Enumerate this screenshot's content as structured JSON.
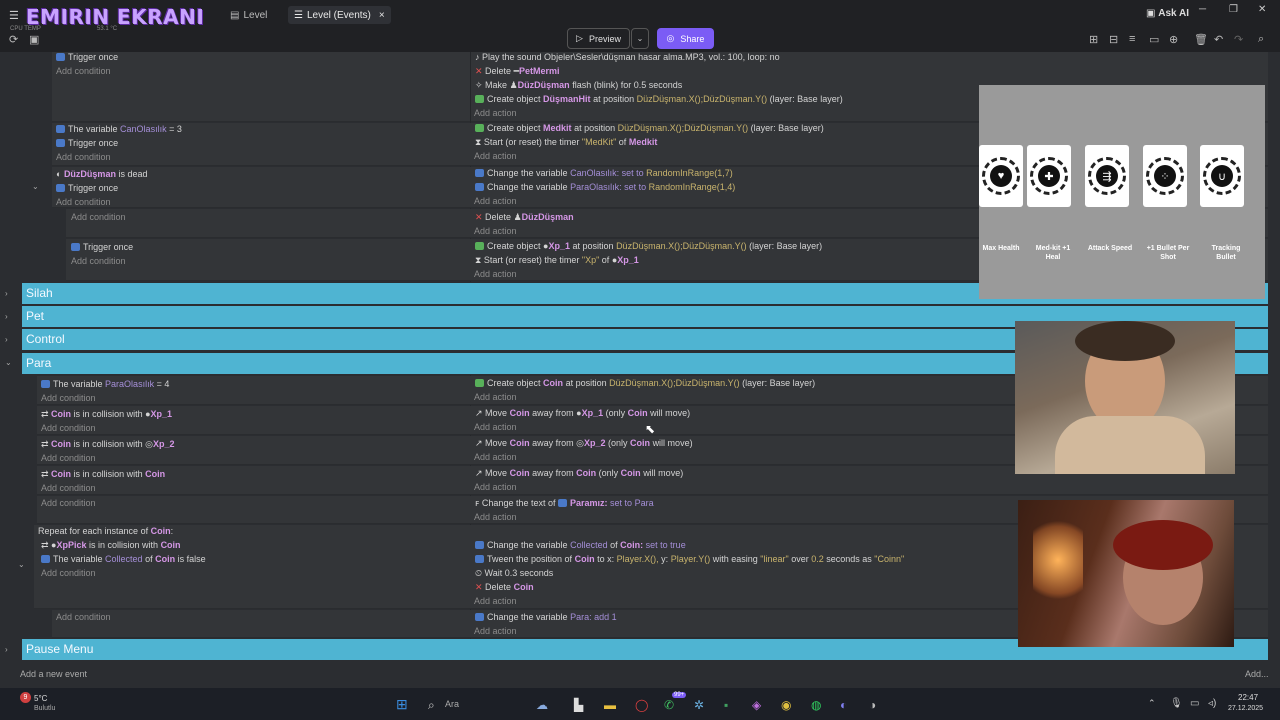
{
  "title_bar": {
    "brand": "EMIRIN EKRANI",
    "tabs": [
      {
        "label": "Level"
      },
      {
        "label": "Level (Events)"
      }
    ],
    "mini_left": "CPU TEMP",
    "mini_temp": "53.1 °C",
    "ask_ai": "Ask AI"
  },
  "toolbar": {
    "preview": "Preview",
    "share": "Share"
  },
  "events": {
    "add_condition": "Add condition",
    "add_action": "Add action",
    "trigger_once": "Trigger once"
  },
  "e1": {
    "a1": "Play the sound Objeler\\Sesler\\düşman hasar alma.MP3, vol.: 100, loop: no",
    "a2_pre": "Delete",
    "a2_obj": "PetMermi",
    "a3_pre": "Make",
    "a3_obj": "DüzDüşman",
    "a3_post": "flash (blink) for 0.5 seconds",
    "a4_pre": "Create object",
    "a4_obj": "DüşmanHit",
    "a4_mid": "at position",
    "a4_val": "DüzDüşman.X();DüzDüşman.Y()",
    "a4_layer": "(layer: Base layer)"
  },
  "e2": {
    "c1_pre": "The variable",
    "c1_var": "CanOlasılık",
    "c1_post": "= 3",
    "a1_pre": "Create object",
    "a1_obj": "Medkit",
    "a1_mid": "at position",
    "a1_val": "DüzDüşman.X();DüzDüşman.Y()",
    "a1_layer": "(layer: Base layer)",
    "a2_pre": "Start (or reset) the timer",
    "a2_val": "\"MedKit\"",
    "a2_of": "of",
    "a2_obj": "Medkit"
  },
  "e3": {
    "c1_obj": "DüzDüşman",
    "c1_post": "is dead",
    "a1_pre": "Change the variable",
    "a1_var": "CanOlasılık:",
    "a1_set": "set to",
    "a1_val": "RandomInRange(1,7)",
    "a2_pre": "Change the variable",
    "a2_var": "ParaOlasılık:",
    "a2_set": "set to",
    "a2_val": "RandomInRange(1,4)"
  },
  "e4": {
    "a1_pre": "Delete",
    "a1_obj": "DüzDüşman"
  },
  "e5": {
    "a1_pre": "Create object",
    "a1_obj": "Xp_1",
    "a1_mid": "at position",
    "a1_val": "DüzDüşman.X();DüzDüşman.Y()",
    "a1_layer": "(layer: Base layer)",
    "a2_pre": "Start (or reset) the timer",
    "a2_val": "\"Xp\"",
    "a2_of": "of",
    "a2_obj": "Xp_1"
  },
  "groups": {
    "silah": "Silah",
    "pet": "Pet",
    "control": "Control",
    "para": "Para",
    "pause": "Pause Menu"
  },
  "para": {
    "c1_pre": "The variable",
    "c1_var": "ParaOlasılık",
    "c1_post": "= 4",
    "a1_pre": "Create object",
    "a1_obj": "Coin",
    "a1_mid": "at position",
    "a1_val": "DüzDüşman.X();DüzDüşman.Y()",
    "a1_layer": "(layer: Base layer)",
    "coll_mid": "is in collision with",
    "coin": "Coin",
    "xp1": "Xp_1",
    "xp2": "Xp_2",
    "move_pre": "Move",
    "move_mid": "away from",
    "move_only": "(only",
    "move_post": "will move)",
    "text_pre": "Change the text of",
    "text_obj": "Paramız:",
    "text_set": "set to",
    "text_val": "Para",
    "repeat_pre": "Repeat for each instance of",
    "repeat_obj": "Coin",
    "xppick": "XpPick",
    "r_c2_pre": "The variable",
    "r_c2_var": "Collected",
    "r_c2_of": "of",
    "r_c2_post": "is false",
    "r_a1_pre": "Change the variable",
    "r_a1_var": "Collected",
    "r_a1_of": "of",
    "r_a1_obj": "Coin:",
    "r_a1_set": "set to true",
    "r_a2_pre": "Tween the position of",
    "r_a2_mid": "to x:",
    "r_a2_x": "Player.X(),",
    "r_a2_y_lbl": "y:",
    "r_a2_y": "Player.Y()",
    "r_a2_post": "with easing",
    "r_a2_ease": "\"linear\"",
    "r_a2_over": "over",
    "r_a2_sec": "0.2",
    "r_a2_secs": "seconds as",
    "r_a2_name": "\"Coinn\"",
    "r_a3": "Wait 0.3 seconds",
    "r_a4_pre": "Delete",
    "last_pre": "Change the variable",
    "last_var": "Para:",
    "last_add": "add",
    "last_val": "1"
  },
  "footer": {
    "add_event": "Add a new event",
    "add_more": "Add..."
  },
  "overlay": {
    "labels": [
      "Max Health",
      "Med-kit +1 Heal",
      "Attack Speed",
      "+1 Bullet Per Shot",
      "Tracking Bullet"
    ]
  },
  "taskbar": {
    "weather_temp": "5°C",
    "weather_desc": "Bulutlu",
    "badge": "9",
    "search": "Ara",
    "time": "22:47",
    "date": "27.12.2025",
    "chat_badge": "99+"
  }
}
